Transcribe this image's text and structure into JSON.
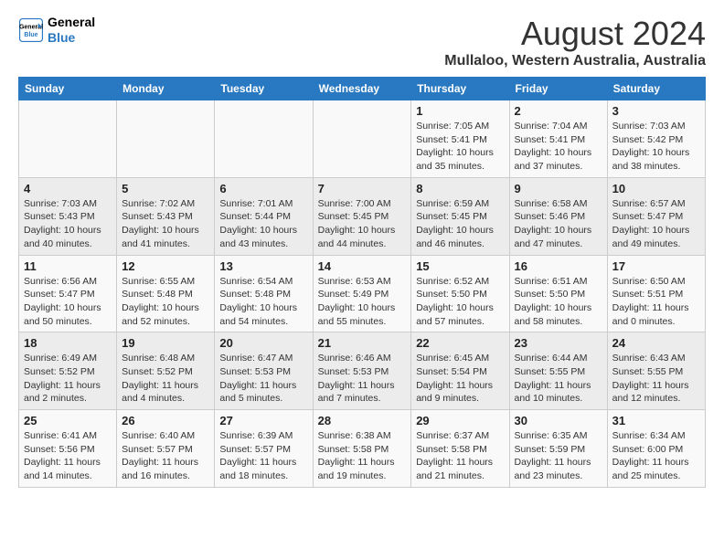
{
  "logo": {
    "line1": "General",
    "line2": "Blue"
  },
  "title": "August 2024",
  "subtitle": "Mullaloo, Western Australia, Australia",
  "days_of_week": [
    "Sunday",
    "Monday",
    "Tuesday",
    "Wednesday",
    "Thursday",
    "Friday",
    "Saturday"
  ],
  "weeks": [
    [
      {
        "day": "",
        "info": ""
      },
      {
        "day": "",
        "info": ""
      },
      {
        "day": "",
        "info": ""
      },
      {
        "day": "",
        "info": ""
      },
      {
        "day": "1",
        "info": "Sunrise: 7:05 AM\nSunset: 5:41 PM\nDaylight: 10 hours\nand 35 minutes."
      },
      {
        "day": "2",
        "info": "Sunrise: 7:04 AM\nSunset: 5:41 PM\nDaylight: 10 hours\nand 37 minutes."
      },
      {
        "day": "3",
        "info": "Sunrise: 7:03 AM\nSunset: 5:42 PM\nDaylight: 10 hours\nand 38 minutes."
      }
    ],
    [
      {
        "day": "4",
        "info": "Sunrise: 7:03 AM\nSunset: 5:43 PM\nDaylight: 10 hours\nand 40 minutes."
      },
      {
        "day": "5",
        "info": "Sunrise: 7:02 AM\nSunset: 5:43 PM\nDaylight: 10 hours\nand 41 minutes."
      },
      {
        "day": "6",
        "info": "Sunrise: 7:01 AM\nSunset: 5:44 PM\nDaylight: 10 hours\nand 43 minutes."
      },
      {
        "day": "7",
        "info": "Sunrise: 7:00 AM\nSunset: 5:45 PM\nDaylight: 10 hours\nand 44 minutes."
      },
      {
        "day": "8",
        "info": "Sunrise: 6:59 AM\nSunset: 5:45 PM\nDaylight: 10 hours\nand 46 minutes."
      },
      {
        "day": "9",
        "info": "Sunrise: 6:58 AM\nSunset: 5:46 PM\nDaylight: 10 hours\nand 47 minutes."
      },
      {
        "day": "10",
        "info": "Sunrise: 6:57 AM\nSunset: 5:47 PM\nDaylight: 10 hours\nand 49 minutes."
      }
    ],
    [
      {
        "day": "11",
        "info": "Sunrise: 6:56 AM\nSunset: 5:47 PM\nDaylight: 10 hours\nand 50 minutes."
      },
      {
        "day": "12",
        "info": "Sunrise: 6:55 AM\nSunset: 5:48 PM\nDaylight: 10 hours\nand 52 minutes."
      },
      {
        "day": "13",
        "info": "Sunrise: 6:54 AM\nSunset: 5:48 PM\nDaylight: 10 hours\nand 54 minutes."
      },
      {
        "day": "14",
        "info": "Sunrise: 6:53 AM\nSunset: 5:49 PM\nDaylight: 10 hours\nand 55 minutes."
      },
      {
        "day": "15",
        "info": "Sunrise: 6:52 AM\nSunset: 5:50 PM\nDaylight: 10 hours\nand 57 minutes."
      },
      {
        "day": "16",
        "info": "Sunrise: 6:51 AM\nSunset: 5:50 PM\nDaylight: 10 hours\nand 58 minutes."
      },
      {
        "day": "17",
        "info": "Sunrise: 6:50 AM\nSunset: 5:51 PM\nDaylight: 11 hours\nand 0 minutes."
      }
    ],
    [
      {
        "day": "18",
        "info": "Sunrise: 6:49 AM\nSunset: 5:52 PM\nDaylight: 11 hours\nand 2 minutes."
      },
      {
        "day": "19",
        "info": "Sunrise: 6:48 AM\nSunset: 5:52 PM\nDaylight: 11 hours\nand 4 minutes."
      },
      {
        "day": "20",
        "info": "Sunrise: 6:47 AM\nSunset: 5:53 PM\nDaylight: 11 hours\nand 5 minutes."
      },
      {
        "day": "21",
        "info": "Sunrise: 6:46 AM\nSunset: 5:53 PM\nDaylight: 11 hours\nand 7 minutes."
      },
      {
        "day": "22",
        "info": "Sunrise: 6:45 AM\nSunset: 5:54 PM\nDaylight: 11 hours\nand 9 minutes."
      },
      {
        "day": "23",
        "info": "Sunrise: 6:44 AM\nSunset: 5:55 PM\nDaylight: 11 hours\nand 10 minutes."
      },
      {
        "day": "24",
        "info": "Sunrise: 6:43 AM\nSunset: 5:55 PM\nDaylight: 11 hours\nand 12 minutes."
      }
    ],
    [
      {
        "day": "25",
        "info": "Sunrise: 6:41 AM\nSunset: 5:56 PM\nDaylight: 11 hours\nand 14 minutes."
      },
      {
        "day": "26",
        "info": "Sunrise: 6:40 AM\nSunset: 5:57 PM\nDaylight: 11 hours\nand 16 minutes."
      },
      {
        "day": "27",
        "info": "Sunrise: 6:39 AM\nSunset: 5:57 PM\nDaylight: 11 hours\nand 18 minutes."
      },
      {
        "day": "28",
        "info": "Sunrise: 6:38 AM\nSunset: 5:58 PM\nDaylight: 11 hours\nand 19 minutes."
      },
      {
        "day": "29",
        "info": "Sunrise: 6:37 AM\nSunset: 5:58 PM\nDaylight: 11 hours\nand 21 minutes."
      },
      {
        "day": "30",
        "info": "Sunrise: 6:35 AM\nSunset: 5:59 PM\nDaylight: 11 hours\nand 23 minutes."
      },
      {
        "day": "31",
        "info": "Sunrise: 6:34 AM\nSunset: 6:00 PM\nDaylight: 11 hours\nand 25 minutes."
      }
    ]
  ]
}
